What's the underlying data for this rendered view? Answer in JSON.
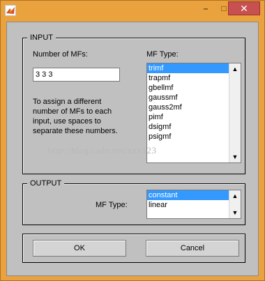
{
  "window": {
    "app_icon": "matlab-icon",
    "controls": {
      "minimize": "–",
      "maximize": "□",
      "close": "✕"
    }
  },
  "input_panel": {
    "title": "INPUT",
    "num_mfs_label": "Number of MFs:",
    "num_mfs_value": "3 3 3",
    "hint_lines": [
      "To assign a different",
      "number of MFs to each",
      "input, use spaces to",
      "separate these numbers."
    ],
    "mf_type_label": "MF Type:",
    "mf_types": [
      "trimf",
      "trapmf",
      "gbellmf",
      "gaussmf",
      "gauss2mf",
      "pimf",
      "dsigmf",
      "psigmf"
    ],
    "selected_index": 0
  },
  "output_panel": {
    "title": "OUTPUT",
    "mf_type_label": "MF Type:",
    "mf_types": [
      "constant",
      "linear"
    ],
    "selected_index": 0
  },
  "buttons": {
    "ok": "OK",
    "cancel": "Cancel"
  },
  "watermark": "http://blog.csdn.net/xxx123",
  "colors": {
    "title_bar": "#e9a23d",
    "close_button": "#c75050",
    "dialog_background": "#c0c0c0",
    "selection": "#3399ff"
  }
}
